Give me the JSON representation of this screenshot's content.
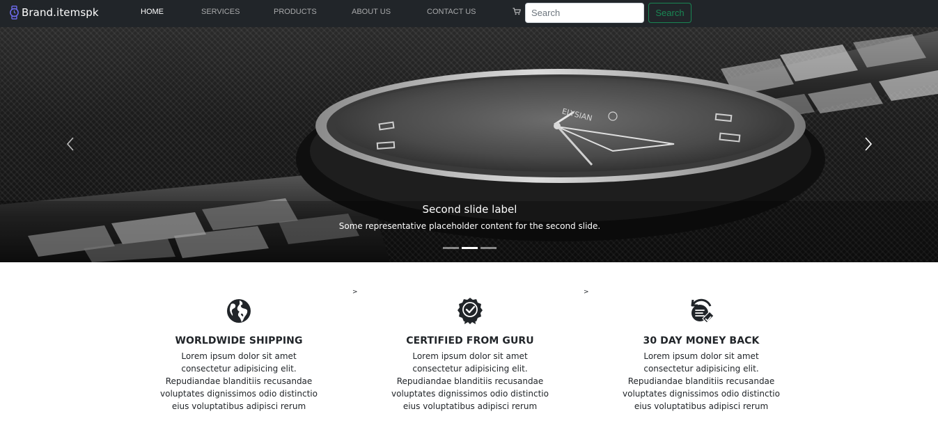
{
  "navbar": {
    "brand": "Brand.itemspk",
    "links": [
      {
        "label": "HOME",
        "active": true
      },
      {
        "label": "SERVICES",
        "active": false
      },
      {
        "label": "PRODUCTS",
        "active": false
      },
      {
        "label": "ABOUT US",
        "active": false
      },
      {
        "label": "CONTACT US",
        "active": false
      }
    ],
    "cart_icon": "cart-icon",
    "search": {
      "placeholder": "Search",
      "value": "",
      "button_label": "Search"
    }
  },
  "carousel": {
    "caption_title": "Second slide label",
    "caption_text": "Some representative placeholder content for the second slide.",
    "slide_count": 3,
    "active_slide": 2,
    "prev_icon": "chevron-left-icon",
    "next_icon": "chevron-right-icon",
    "watch_dial_text": "ELYSIAN"
  },
  "features": {
    "separator": ">",
    "items": [
      {
        "icon": "globe-icon",
        "title": "WORLDWIDE SHIPPING",
        "text": "Lorem ipsum dolor sit amet consectetur adipisicing elit. Repudiandae blanditiis recusandae voluptates dignissimos odio distinctio eius voluptatibus adipisci rerum"
      },
      {
        "icon": "certified-badge-icon",
        "title": "CERTIFIED FROM GURU",
        "text": "Lorem ipsum dolor sit amet consectetur adipisicing elit. Repudiandae blanditiis recusandae voluptates dignissimos odio distinctio eius voluptatibus adipisci rerum"
      },
      {
        "icon": "money-back-icon",
        "title": "30 DAY MONEY BACK",
        "text": "Lorem ipsum dolor sit amet consectetur adipisicing elit. Repudiandae blanditiis recusandae voluptates dignissimos odio distinctio eius voluptatibus adipisci rerum"
      }
    ]
  },
  "colors": {
    "navbar_bg": "#212529",
    "success": "#198754",
    "text_dark": "#212529",
    "brand_icon": "#6f6cf0"
  }
}
